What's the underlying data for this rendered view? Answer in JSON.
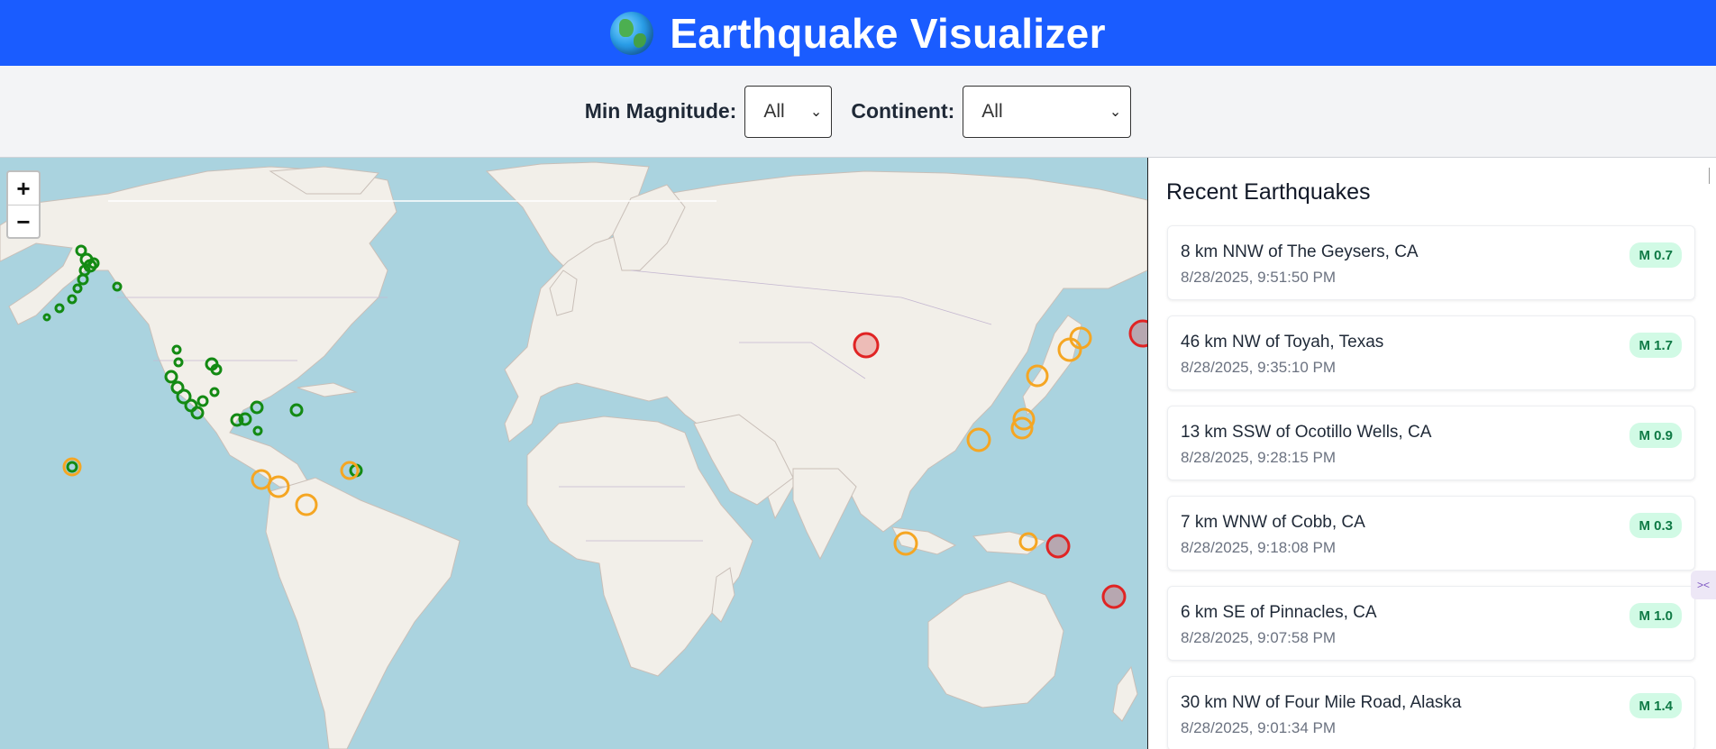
{
  "header": {
    "title": "Earthquake Visualizer",
    "logo_icon": "globe-icon",
    "bg_color": "#1a5cff"
  },
  "filters": {
    "min_magnitude": {
      "label": "Min Magnitude:",
      "value": "All"
    },
    "continent": {
      "label": "Continent:",
      "value": "All"
    }
  },
  "map": {
    "zoom_in_label": "+",
    "zoom_out_label": "−",
    "marker_colors": {
      "low": "#138a13",
      "medium": "#f5a623",
      "high": "#e02424"
    }
  },
  "panel": {
    "title": "Recent Earthquakes",
    "quakes": [
      {
        "place": "8 km NNW of The Geysers, CA",
        "time": "8/28/2025, 9:51:50 PM",
        "mag": "M 0.7"
      },
      {
        "place": "46 km NW of Toyah, Texas",
        "time": "8/28/2025, 9:35:10 PM",
        "mag": "M 1.7"
      },
      {
        "place": "13 km SSW of Ocotillo Wells, CA",
        "time": "8/28/2025, 9:28:15 PM",
        "mag": "M 0.9"
      },
      {
        "place": "7 km WNW of Cobb, CA",
        "time": "8/28/2025, 9:18:08 PM",
        "mag": "M 0.3"
      },
      {
        "place": "6 km SE of Pinnacles, CA",
        "time": "8/28/2025, 9:07:58 PM",
        "mag": "M 1.0"
      },
      {
        "place": "30 km NW of Four Mile Road, Alaska",
        "time": "8/28/2025, 9:01:34 PM",
        "mag": "M 1.4"
      }
    ]
  }
}
